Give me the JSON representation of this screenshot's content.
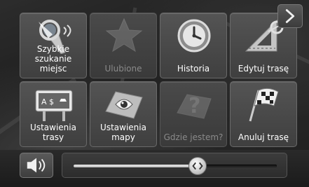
{
  "menu": {
    "tiles": [
      {
        "label": "Szybkie\nszukanie miejsc",
        "icon": "quick-search-icon",
        "enabled": true
      },
      {
        "label": "Ulubione",
        "icon": "favorites-star-icon",
        "enabled": false
      },
      {
        "label": "Historia",
        "icon": "history-clock-icon",
        "enabled": true
      },
      {
        "label": "Edytuj trasę",
        "icon": "edit-route-icon",
        "enabled": true
      },
      {
        "label": "Ustawienia\ntrasy",
        "icon": "route-settings-icon",
        "enabled": true
      },
      {
        "label": "Ustawienia\nmapy",
        "icon": "map-settings-icon",
        "enabled": true
      },
      {
        "label": "Gdzie jestem?",
        "icon": "where-am-i-icon",
        "enabled": false
      },
      {
        "label": "Anuluj trasę",
        "icon": "cancel-route-flag-icon",
        "enabled": true
      }
    ]
  },
  "navigation": {
    "next_icon": "chevron-right-icon"
  },
  "volume": {
    "icon": "speaker-icon",
    "level": 0.61
  },
  "colors": {
    "tile": "#4a4a4a",
    "text": "#ffffff",
    "disabled_text": "#8a8a8a"
  }
}
